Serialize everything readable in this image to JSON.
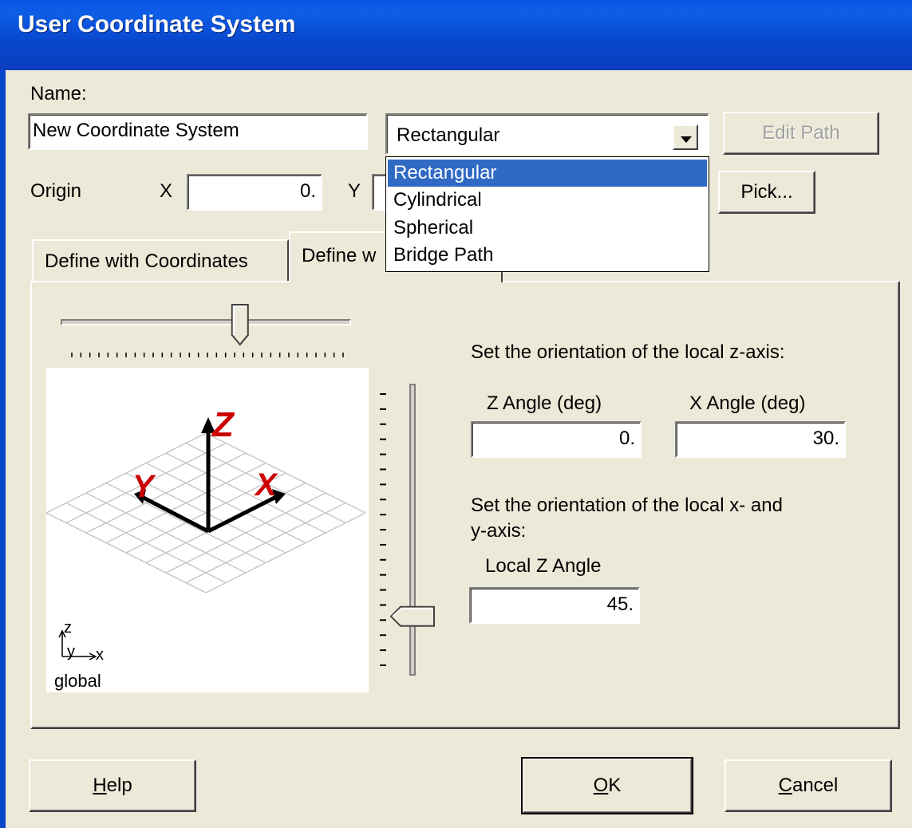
{
  "window": {
    "title": "User Coordinate System"
  },
  "name_label": "Name:",
  "name_value": "New Coordinate System",
  "coord_type": {
    "selected": "Rectangular",
    "options": [
      "Rectangular",
      "Cylindrical",
      "Spherical",
      "Bridge Path"
    ]
  },
  "buttons": {
    "edit_path": "Edit Path",
    "pick": "Pick...",
    "help": "Help",
    "ok": "OK",
    "cancel": "Cancel"
  },
  "origin": {
    "label": "Origin",
    "x_label": "X",
    "x_value": "0.",
    "y_label": "Y"
  },
  "tabs": [
    {
      "label": "Define with Coordinates",
      "active": false
    },
    {
      "label": "Define w",
      "active": true
    }
  ],
  "preview": {
    "z_label": "Z",
    "x_label": "X",
    "y_label": "Y",
    "global_label": "global",
    "global_triad": {
      "z": "z",
      "y": "y",
      "x": "x"
    }
  },
  "z_axis": {
    "heading": "Set the orientation of the local z-axis:",
    "z_angle_label": "Z Angle (deg)",
    "z_angle_value": "0.",
    "x_angle_label": "X Angle (deg)",
    "x_angle_value": "30."
  },
  "xy_axis": {
    "heading_line1": "Set the orientation of the local x- and",
    "heading_line2": "y-axis:",
    "local_z_label": "Local Z Angle",
    "local_z_value": "45."
  },
  "sliders": {
    "horizontal_level": 0.62,
    "vertical_level": 0.82
  },
  "colors": {
    "title_bar": "#0a54e4",
    "dialog_bg": "#ece9d8",
    "selection": "#316ac5",
    "axis_label": "#cc0000"
  }
}
